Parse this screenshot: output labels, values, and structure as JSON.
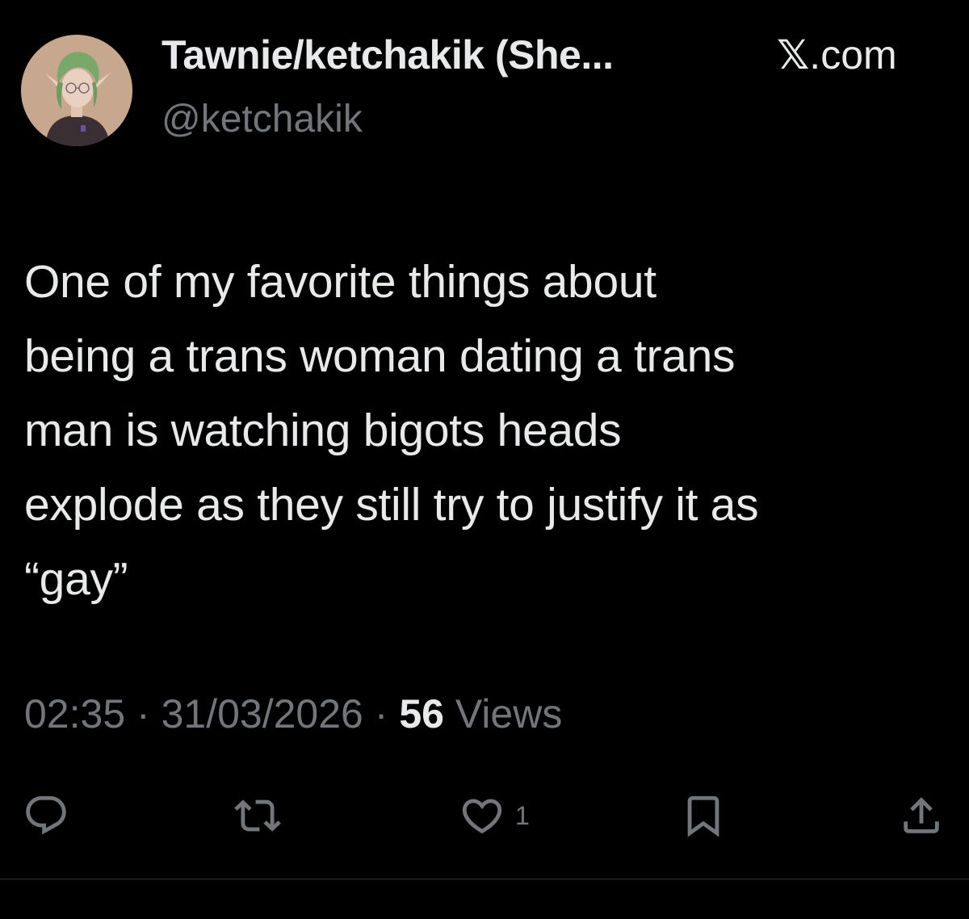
{
  "author": {
    "display_name": "Tawnie/ketchakik (She...",
    "handle": "@ketchakik",
    "avatar_icon": "avatar-green-haired-elf-character"
  },
  "source": {
    "logo": "𝕏",
    "label": ".com"
  },
  "tweet": {
    "text": "One of my favorite things about\nbeing a trans woman dating a trans\nman is watching bigots heads\nexplode as they still try to justify it as\n“gay”",
    "time": "02:35",
    "date": "31/03/2026",
    "separator": "·",
    "views_count": "56",
    "views_label": "Views"
  },
  "actions": {
    "reply_icon": "reply-icon",
    "retweet_icon": "retweet-icon",
    "like_icon": "heart-icon",
    "like_count": "1",
    "bookmark_icon": "bookmark-icon",
    "share_icon": "share-icon"
  },
  "colors": {
    "background": "#000000",
    "text": "#e7e9ea",
    "secondary_text": "#71767b",
    "divider": "#2f3336"
  }
}
